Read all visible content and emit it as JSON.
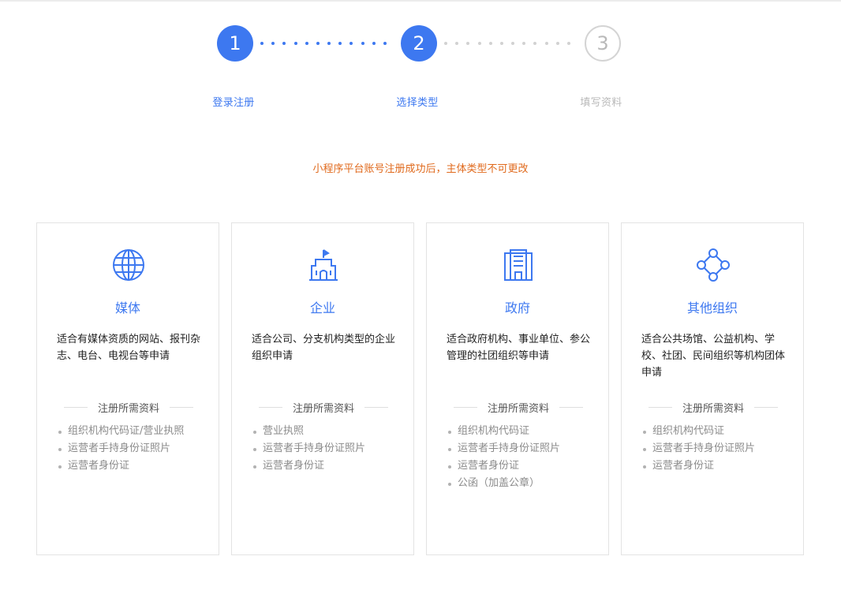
{
  "steps": [
    {
      "number": "1",
      "label": "登录注册",
      "state": "done"
    },
    {
      "number": "2",
      "label": "选择类型",
      "state": "current"
    },
    {
      "number": "3",
      "label": "填写资料",
      "state": "pending"
    }
  ],
  "notice": "小程序平台账号注册成功后，主体类型不可更改",
  "colors": {
    "accent": "#3d78f0",
    "warning": "#e06a1d",
    "muted": "#b9b9b9"
  },
  "requirements_heading": "注册所需资料",
  "cards": [
    {
      "icon": "globe-icon",
      "title": "媒体",
      "description": "适合有媒体资质的网站、报刊杂志、电台、电视台等申请",
      "requirements": [
        "组织机构代码证/营业执照",
        "运营者手持身份证照片",
        "运营者身份证"
      ]
    },
    {
      "icon": "building-flag-icon",
      "title": "企业",
      "description": "适合公司、分支机构类型的企业组织申请",
      "requirements": [
        "营业执照",
        "运营者手持身份证照片",
        "运营者身份证"
      ]
    },
    {
      "icon": "government-building-icon",
      "title": "政府",
      "description": "适合政府机构、事业单位、参公管理的社团组织等申请",
      "requirements": [
        "组织机构代码证",
        "运营者手持身份证照片",
        "运营者身份证",
        "公函（加盖公章）"
      ]
    },
    {
      "icon": "network-nodes-icon",
      "title": "其他组织",
      "description": "适合公共场馆、公益机构、学校、社团、民间组织等机构团体申请",
      "requirements": [
        "组织机构代码证",
        "运营者手持身份证照片",
        "运营者身份证"
      ]
    }
  ]
}
